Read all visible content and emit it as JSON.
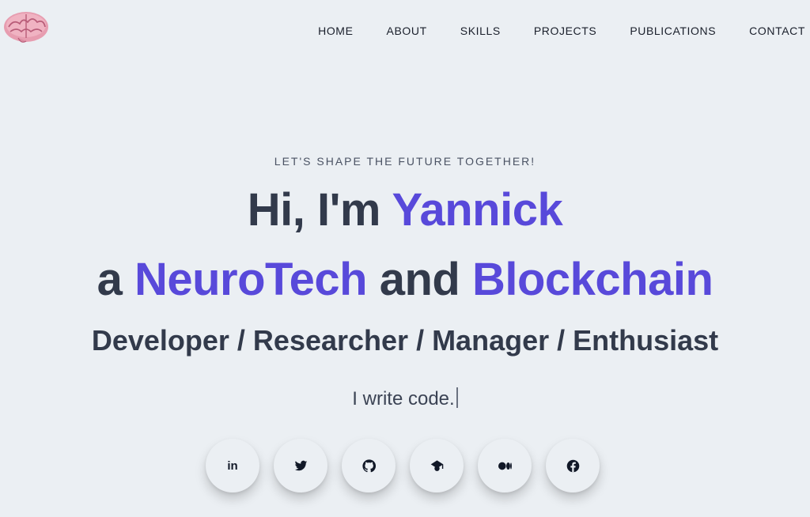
{
  "logo": {
    "icon": "brain-icon"
  },
  "nav": {
    "items": [
      {
        "label": "HOME"
      },
      {
        "label": "ABOUT"
      },
      {
        "label": "SKILLS"
      },
      {
        "label": "PROJECTS"
      },
      {
        "label": "PUBLICATIONS"
      },
      {
        "label": "CONTACT"
      }
    ]
  },
  "hero": {
    "tagline": "LET'S SHAPE THE FUTURE TOGETHER!",
    "greeting": "Hi, I'm ",
    "name": "Yannick",
    "line2_prefix": "a ",
    "field1": "NeuroTech",
    "line2_middle": " and ",
    "field2": "Blockchain",
    "roles": "Developer / Researcher / Manager / Enthusiast",
    "typed_text": "I write code."
  },
  "socials": [
    {
      "icon": "linkedin-icon",
      "glyph": "in"
    },
    {
      "icon": "twitter-icon"
    },
    {
      "icon": "github-icon"
    },
    {
      "icon": "graduation-cap-icon"
    },
    {
      "icon": "medium-icon"
    },
    {
      "icon": "facebook-icon"
    }
  ],
  "colors": {
    "background": "#ebeff3",
    "text": "#323a4b",
    "accent": "#5849da"
  }
}
